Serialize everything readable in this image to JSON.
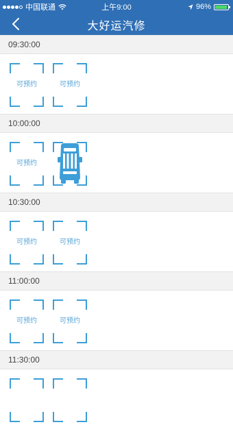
{
  "status_bar": {
    "carrier": "中国联通",
    "time": "上午9:00",
    "battery": "96%",
    "battery_level": 0.96
  },
  "nav": {
    "title": "大好运汽修",
    "back_icon": "chevron-left-icon"
  },
  "colors": {
    "primary": "#2f6fb5",
    "slot_accent": "#3d9ed8",
    "header_bg": "#f2f2f2"
  },
  "schedule": [
    {
      "time": "09:30:00",
      "slots": [
        {
          "label": "可预约",
          "booked": false
        },
        {
          "label": "可预约",
          "booked": false
        }
      ]
    },
    {
      "time": "10:00:00",
      "slots": [
        {
          "label": "可预约",
          "booked": false
        },
        {
          "label": "",
          "booked": true,
          "icon": "car-icon"
        }
      ]
    },
    {
      "time": "10:30:00",
      "slots": [
        {
          "label": "可预约",
          "booked": false
        },
        {
          "label": "可预约",
          "booked": false
        }
      ]
    },
    {
      "time": "11:00:00",
      "slots": [
        {
          "label": "可预约",
          "booked": false
        },
        {
          "label": "可预约",
          "booked": false
        }
      ]
    },
    {
      "time": "11:30:00",
      "slots": [
        {
          "label": "",
          "booked": false
        },
        {
          "label": "",
          "booked": false
        }
      ]
    }
  ]
}
